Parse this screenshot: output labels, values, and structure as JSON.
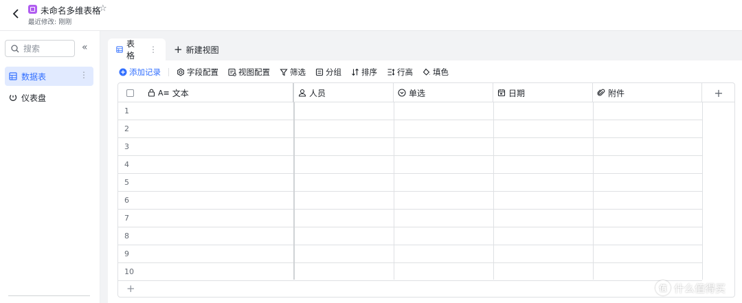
{
  "header": {
    "title": "未命名多维表格",
    "subtitle": "最近修改: 刚刚"
  },
  "sidebar": {
    "search_placeholder": "搜索",
    "items": [
      {
        "label": "数据表",
        "active": true
      },
      {
        "label": "仪表盘",
        "active": false
      }
    ]
  },
  "tabs": [
    {
      "label": "表格",
      "active": true
    },
    {
      "label": "新建视图",
      "active": false
    }
  ],
  "toolbar": {
    "add_record": "添加记录",
    "field_config": "字段配置",
    "view_config": "视图配置",
    "filter": "筛选",
    "group": "分组",
    "sort": "排序",
    "row_height": "行高",
    "fill_color": "填色"
  },
  "table": {
    "columns": [
      {
        "label": "文本",
        "icon": "text-field-icon"
      },
      {
        "label": "人员",
        "icon": "person-icon"
      },
      {
        "label": "单选",
        "icon": "single-select-icon"
      },
      {
        "label": "日期",
        "icon": "calendar-icon"
      },
      {
        "label": "附件",
        "icon": "attachment-icon"
      }
    ],
    "row_numbers": [
      "1",
      "2",
      "3",
      "4",
      "5",
      "6",
      "7",
      "8",
      "9",
      "10"
    ],
    "add_row_label": "+",
    "add_column_label": "+"
  },
  "watermark": {
    "logo_text": "值",
    "text": "什么值得买"
  },
  "colors": {
    "accent": "#3370ff",
    "active_bg": "#e1eaff",
    "border": "#dee0e3",
    "main_bg": "#f2f3f5"
  }
}
